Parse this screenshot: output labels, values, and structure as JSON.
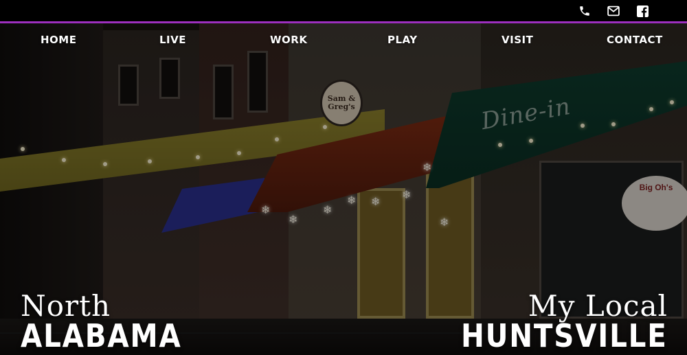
{
  "topbar": {
    "accent_color": "#9d2fbf",
    "icons": [
      {
        "name": "phone-icon"
      },
      {
        "name": "envelope-icon"
      },
      {
        "name": "facebook-icon"
      }
    ]
  },
  "nav": {
    "items": [
      {
        "label": "HOME"
      },
      {
        "label": "LIVE"
      },
      {
        "label": "WORK"
      },
      {
        "label": "PLAY"
      },
      {
        "label": "VISIT"
      },
      {
        "label": "CONTACT"
      }
    ]
  },
  "hero": {
    "scene_signs": {
      "sam_greg": "Sam & Greg's",
      "dine_in": "Dine-in",
      "big_ohs": "Big Oh's"
    },
    "left_heading": {
      "line1": "North",
      "line2": "ALABAMA"
    },
    "right_heading": {
      "line1": "My Local",
      "line2": "HUNTSVILLE"
    }
  }
}
